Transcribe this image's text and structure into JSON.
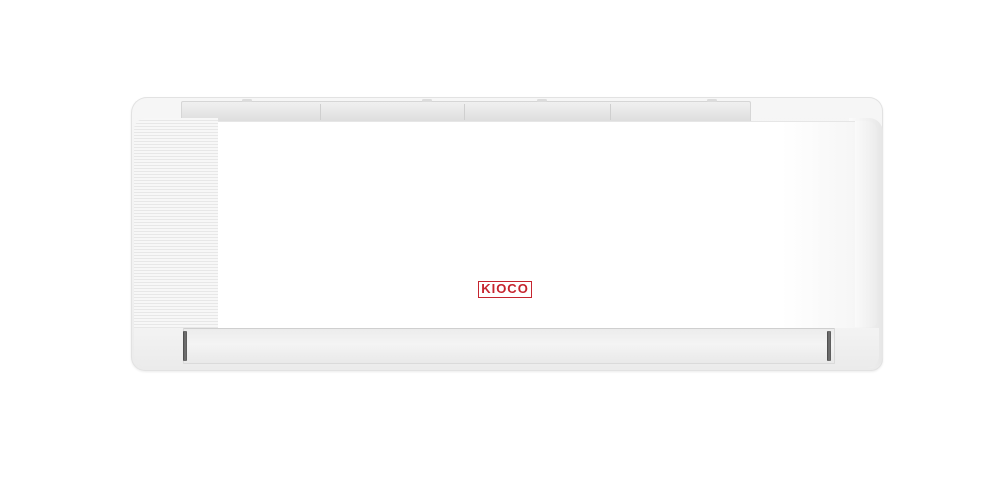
{
  "product": {
    "type": "wall-mounted air conditioner",
    "brand_logo": "KIOCO",
    "brand_color": "#c6252f",
    "body_color": "#f4f4f4"
  },
  "icons": [
    "kioco-logo"
  ]
}
